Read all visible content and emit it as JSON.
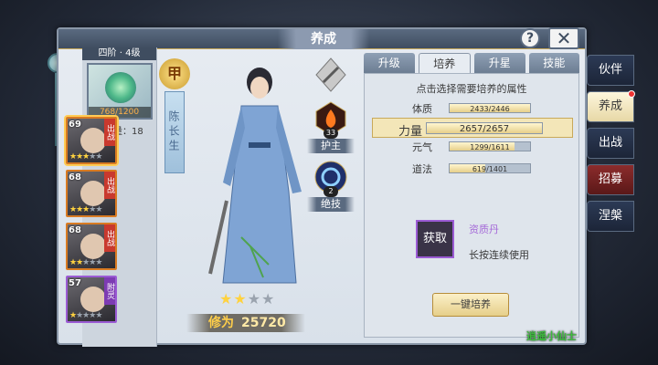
{
  "window": {
    "title": "养成",
    "help_label": "?",
    "close_label": "✕"
  },
  "gear": {
    "header": "四阶 · 4级",
    "count": "768/1200"
  },
  "partners": {
    "count_label": "伙伴数量：18",
    "cards": [
      {
        "level": "69",
        "tag": "出战",
        "stars": 3,
        "max_stars": 5,
        "frame": "orange",
        "selected": true
      },
      {
        "level": "68",
        "tag": "出战",
        "stars": 3,
        "max_stars": 5,
        "frame": "orange",
        "selected": false
      },
      {
        "level": "68",
        "tag": "出战",
        "stars": 2,
        "max_stars": 5,
        "frame": "orange",
        "selected": false
      },
      {
        "level": "57",
        "tag": "附灵",
        "stars": 1,
        "max_stars": 5,
        "frame": "purple",
        "selected": false
      }
    ]
  },
  "hero": {
    "rank": "甲",
    "name": "陈长生",
    "stars": 2,
    "max_stars": 4,
    "power_label": "修为",
    "power_value": "25720"
  },
  "skills": [
    {
      "label": "",
      "icon": "sword-icon",
      "level": ""
    },
    {
      "label": "护主",
      "icon": "flame-icon",
      "level": "33"
    },
    {
      "label": "绝技",
      "icon": "spiral-icon",
      "level": "2"
    }
  ],
  "tabs": [
    {
      "label": "升级",
      "active": false
    },
    {
      "label": "培养",
      "active": true
    },
    {
      "label": "升星",
      "active": false
    },
    {
      "label": "技能",
      "active": false
    }
  ],
  "training": {
    "hint": "点击选择需要培养的属性",
    "attributes": [
      {
        "name": "体质",
        "value": "2433/2446",
        "ratio": 0.995,
        "selected": false
      },
      {
        "name": "力量",
        "value": "2657/2657",
        "ratio": 1.0,
        "selected": true
      },
      {
        "name": "元气",
        "value": "1299/1611",
        "ratio": 0.806,
        "selected": false
      },
      {
        "name": "道法",
        "value": "619/1401",
        "ratio": 0.442,
        "selected": false
      }
    ],
    "get_label": "获取",
    "item_name": "资质丹",
    "item_note": "长按连续使用",
    "train_button": "一键培养"
  },
  "watermark": "逍遥小仙士",
  "side_menu": [
    {
      "label": "伙伴",
      "style": "normal",
      "dot": false
    },
    {
      "label": "养成",
      "style": "active",
      "dot": true
    },
    {
      "label": "出战",
      "style": "normal",
      "dot": false
    },
    {
      "label": "招募",
      "style": "red",
      "dot": false
    },
    {
      "label": "涅槃",
      "style": "normal",
      "dot": false
    }
  ],
  "colors": {
    "accent_gold": "#c9a95a",
    "frame_orange": "#d97b22",
    "frame_purple": "#9b5bd4",
    "item_purple": "#a56ad8"
  }
}
